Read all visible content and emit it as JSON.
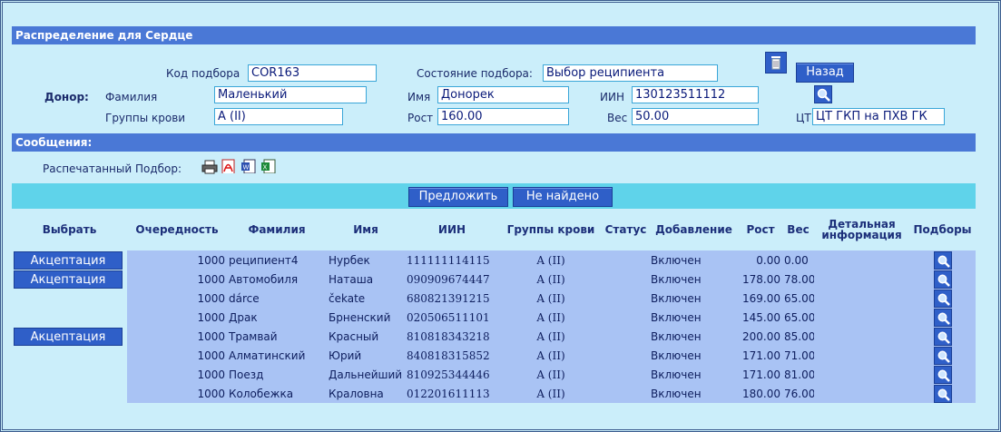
{
  "header": {
    "title": "Распределение для Сердце"
  },
  "form": {
    "code_label": "Код подбора",
    "code_value": "COR163",
    "state_label": "Состояние подбора:",
    "state_value": "Выбор реципиента",
    "back_button": "Назад",
    "donor_label": "Донор:",
    "lastname_label": "Фамилия",
    "lastname_value": "Маленький",
    "firstname_label": "Имя",
    "firstname_value": "Донорек",
    "iin_label": "ИИН",
    "iin_value": "130123511112",
    "blood_label": "Группы крови",
    "blood_value": "A (II)",
    "height_label": "Рост",
    "height_value": "160.00",
    "weight_label": "Вес",
    "weight_value": "50.00",
    "ct_label": "ЦТ",
    "ct_value": "ЦТ ГКП на ПХВ ГК"
  },
  "messages": {
    "title": "Сообщения:",
    "printed_label": "Распечатанный Подбор:"
  },
  "actions": {
    "propose": "Предложить",
    "not_found": "Не найдено"
  },
  "table": {
    "columns": [
      "Выбрать",
      "Очередность",
      "Фамилия",
      "Имя",
      "ИИН",
      "Группы крови",
      "Статус",
      "Добавление",
      "Рост",
      "Вес",
      "Детальная информация",
      "Подборы"
    ],
    "rows": [
      {
        "select": "Акцептация",
        "order": "1000",
        "lastname": "реципиент4",
        "firstname": "Нурбек",
        "iin": "111111114115",
        "blood": "A (II)",
        "status": "",
        "added": "Включен",
        "height": "0.00",
        "weight": "0.00"
      },
      {
        "select": "Акцептация",
        "order": "1000",
        "lastname": "Автомобиля",
        "firstname": "Наташа",
        "iin": "090909674447",
        "blood": "A (II)",
        "status": "",
        "added": "Включен",
        "height": "178.00",
        "weight": "78.00"
      },
      {
        "select": "",
        "order": "1000",
        "lastname": "dárce",
        "firstname": "čekate",
        "iin": "680821391215",
        "blood": "A (II)",
        "status": "",
        "added": "Включен",
        "height": "169.00",
        "weight": "65.00"
      },
      {
        "select": "",
        "order": "1000",
        "lastname": "Драк",
        "firstname": "Брненский",
        "iin": "020506511101",
        "blood": "A (II)",
        "status": "",
        "added": "Включен",
        "height": "145.00",
        "weight": "65.00"
      },
      {
        "select": "Акцептация",
        "order": "1000",
        "lastname": "Трамвай",
        "firstname": "Красный",
        "iin": "810818343218",
        "blood": "A (II)",
        "status": "",
        "added": "Включен",
        "height": "200.00",
        "weight": "85.00"
      },
      {
        "select": "",
        "order": "1000",
        "lastname": "Алматинский",
        "firstname": "Юрий",
        "iin": "840818315852",
        "blood": "A (II)",
        "status": "",
        "added": "Включен",
        "height": "171.00",
        "weight": "71.00"
      },
      {
        "select": "",
        "order": "1000",
        "lastname": "Поезд",
        "firstname": "Дальнейший",
        "iin": "810925344446",
        "blood": "A (II)",
        "status": "",
        "added": "Включен",
        "height": "171.00",
        "weight": "81.00"
      },
      {
        "select": "",
        "order": "1000",
        "lastname": "Колобежка",
        "firstname": "Краловна",
        "iin": "012201611113",
        "blood": "A (II)",
        "status": "",
        "added": "Включен",
        "height": "180.00",
        "weight": "76.00"
      }
    ]
  }
}
